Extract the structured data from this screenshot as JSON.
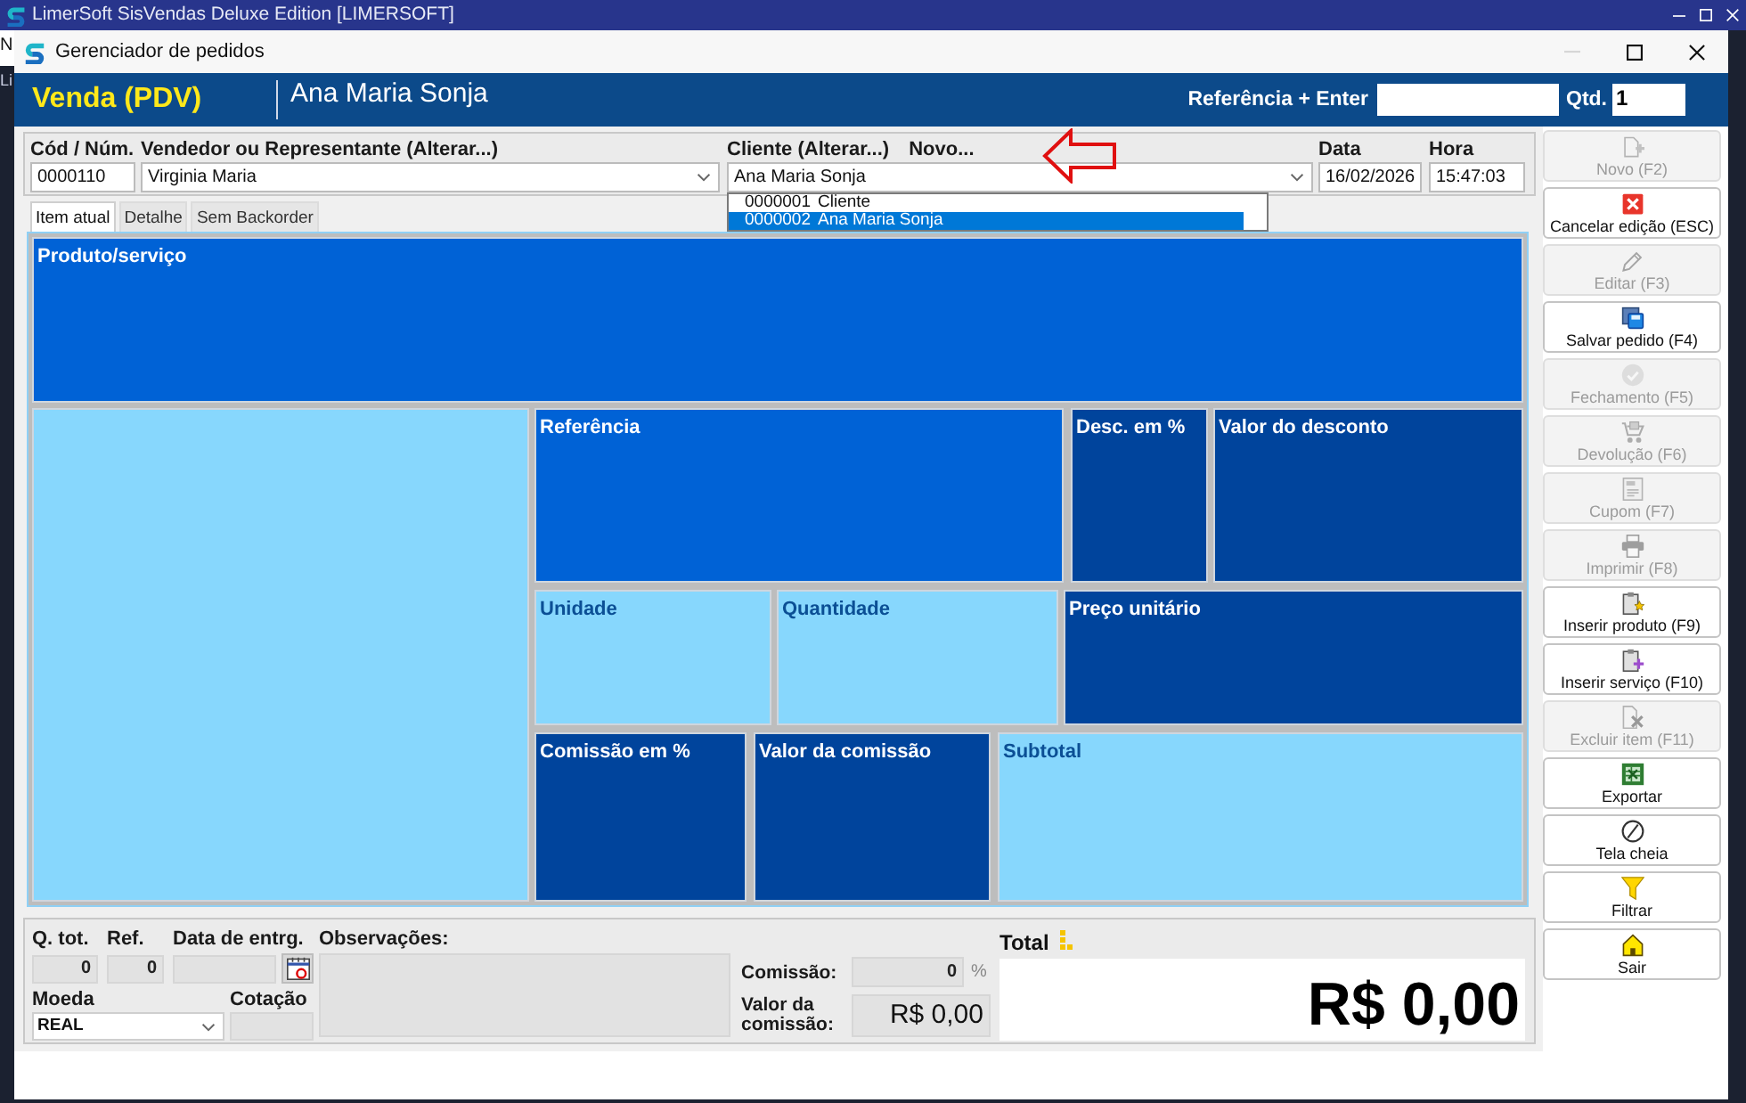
{
  "app_window": {
    "title": "LimerSoft SisVendas Deluxe Edition [LIMERSOFT]",
    "edge_texts": [
      "N",
      "Li"
    ]
  },
  "window": {
    "title": "Gerenciador de pedidos",
    "controls": [
      {
        "kind": "minimize",
        "disabled": true
      },
      {
        "kind": "maximize",
        "disabled": false
      },
      {
        "kind": "close",
        "disabled": false
      }
    ]
  },
  "header": {
    "mode": "Venda (PDV)",
    "customer": "Ana Maria Sonja",
    "reference_label": "Referência + Enter",
    "quantity_label": "Qtd.",
    "quantity_value": "1"
  },
  "order_fields": [
    {
      "kind": "text",
      "label": "Cód / Núm.",
      "value": "0000110"
    },
    {
      "kind": "combo",
      "label": "Vendedor ou Representante (Alterar...)",
      "value": "Virginia Maria"
    },
    {
      "kind": "combo",
      "label": "Cliente (Alterar...)",
      "link": "Novo...",
      "value": "Ana Maria Sonja"
    },
    {
      "kind": "text",
      "label": "Data",
      "value": "16/02/2026"
    },
    {
      "kind": "text",
      "label": "Hora",
      "value": "15:47:03"
    }
  ],
  "client_dropdown": [
    {
      "code": "0000001",
      "name": "Cliente",
      "selected": false
    },
    {
      "code": "0000002",
      "name": "Ana Maria Sonja",
      "selected": true
    }
  ],
  "tabs": [
    {
      "label": "Item atual",
      "selected": true
    },
    {
      "label": "Detalhe",
      "selected": false
    },
    {
      "label": "Sem Backorder",
      "selected": false
    }
  ],
  "item_panel": {
    "product": {
      "label": "Produto/serviço",
      "kind": "medium"
    },
    "side": {
      "kind": "light"
    },
    "rows": [
      [
        {
          "label": "Referência",
          "kind": "medium"
        },
        {
          "label": "Desc. em %",
          "kind": "dark"
        },
        {
          "label": "Valor do desconto",
          "kind": "dark"
        }
      ],
      [
        {
          "label": "Unidade",
          "kind": "light"
        },
        {
          "label": "Quantidade",
          "kind": "light"
        },
        {
          "label": "Preço unitário",
          "kind": "dark"
        }
      ],
      [
        {
          "label": "Comissão em %",
          "kind": "dark"
        },
        {
          "label": "Valor da comissão",
          "kind": "dark"
        },
        {
          "label": "Subtotal",
          "kind": "light"
        }
      ]
    ]
  },
  "footer": {
    "quantity_total": {
      "label": "Q. tot.",
      "value": "0"
    },
    "reference_count": {
      "label": "Ref.",
      "value": "0"
    },
    "delivery_date": {
      "label": "Data de entrg."
    },
    "notes": {
      "label": "Observações:"
    },
    "currency": {
      "label": "Moeda",
      "value": "REAL"
    },
    "exchange_rate": {
      "label": "Cotação"
    },
    "commission": {
      "label": "Comissão:",
      "value": "0",
      "unit": "%"
    },
    "commission_value": {
      "label": "Valor da comissão:",
      "value": "R$ 0,00"
    },
    "total": {
      "label": "Total",
      "value": "R$ 0,00"
    }
  },
  "toolbar": [
    {
      "kind": "new",
      "label": "Novo (F2)",
      "disabled": true
    },
    {
      "kind": "cancel",
      "label": "Cancelar edição (ESC)",
      "disabled": false
    },
    {
      "kind": "edit",
      "label": "Editar (F3)",
      "disabled": true
    },
    {
      "kind": "save",
      "label": "Salvar pedido (F4)",
      "disabled": false
    },
    {
      "kind": "close",
      "label": "Fechamento (F5)",
      "disabled": true
    },
    {
      "kind": "return",
      "label": "Devolução (F6)",
      "disabled": true
    },
    {
      "kind": "coupon",
      "label": "Cupom (F7)",
      "disabled": true
    },
    {
      "kind": "print",
      "label": "Imprimir (F8)",
      "disabled": true
    },
    {
      "kind": "insert_product",
      "label": "Inserir produto (F9)",
      "disabled": false
    },
    {
      "kind": "insert_service",
      "label": "Inserir serviço (F10)",
      "disabled": false
    },
    {
      "kind": "delete_item",
      "label": "Excluir item (F11)",
      "disabled": true
    },
    {
      "kind": "export",
      "label": "Exportar",
      "disabled": false
    },
    {
      "kind": "fullscreen",
      "label": "Tela cheia",
      "disabled": false
    },
    {
      "kind": "filter",
      "label": "Filtrar",
      "disabled": false
    },
    {
      "kind": "exit",
      "label": "Sair",
      "disabled": false
    }
  ]
}
